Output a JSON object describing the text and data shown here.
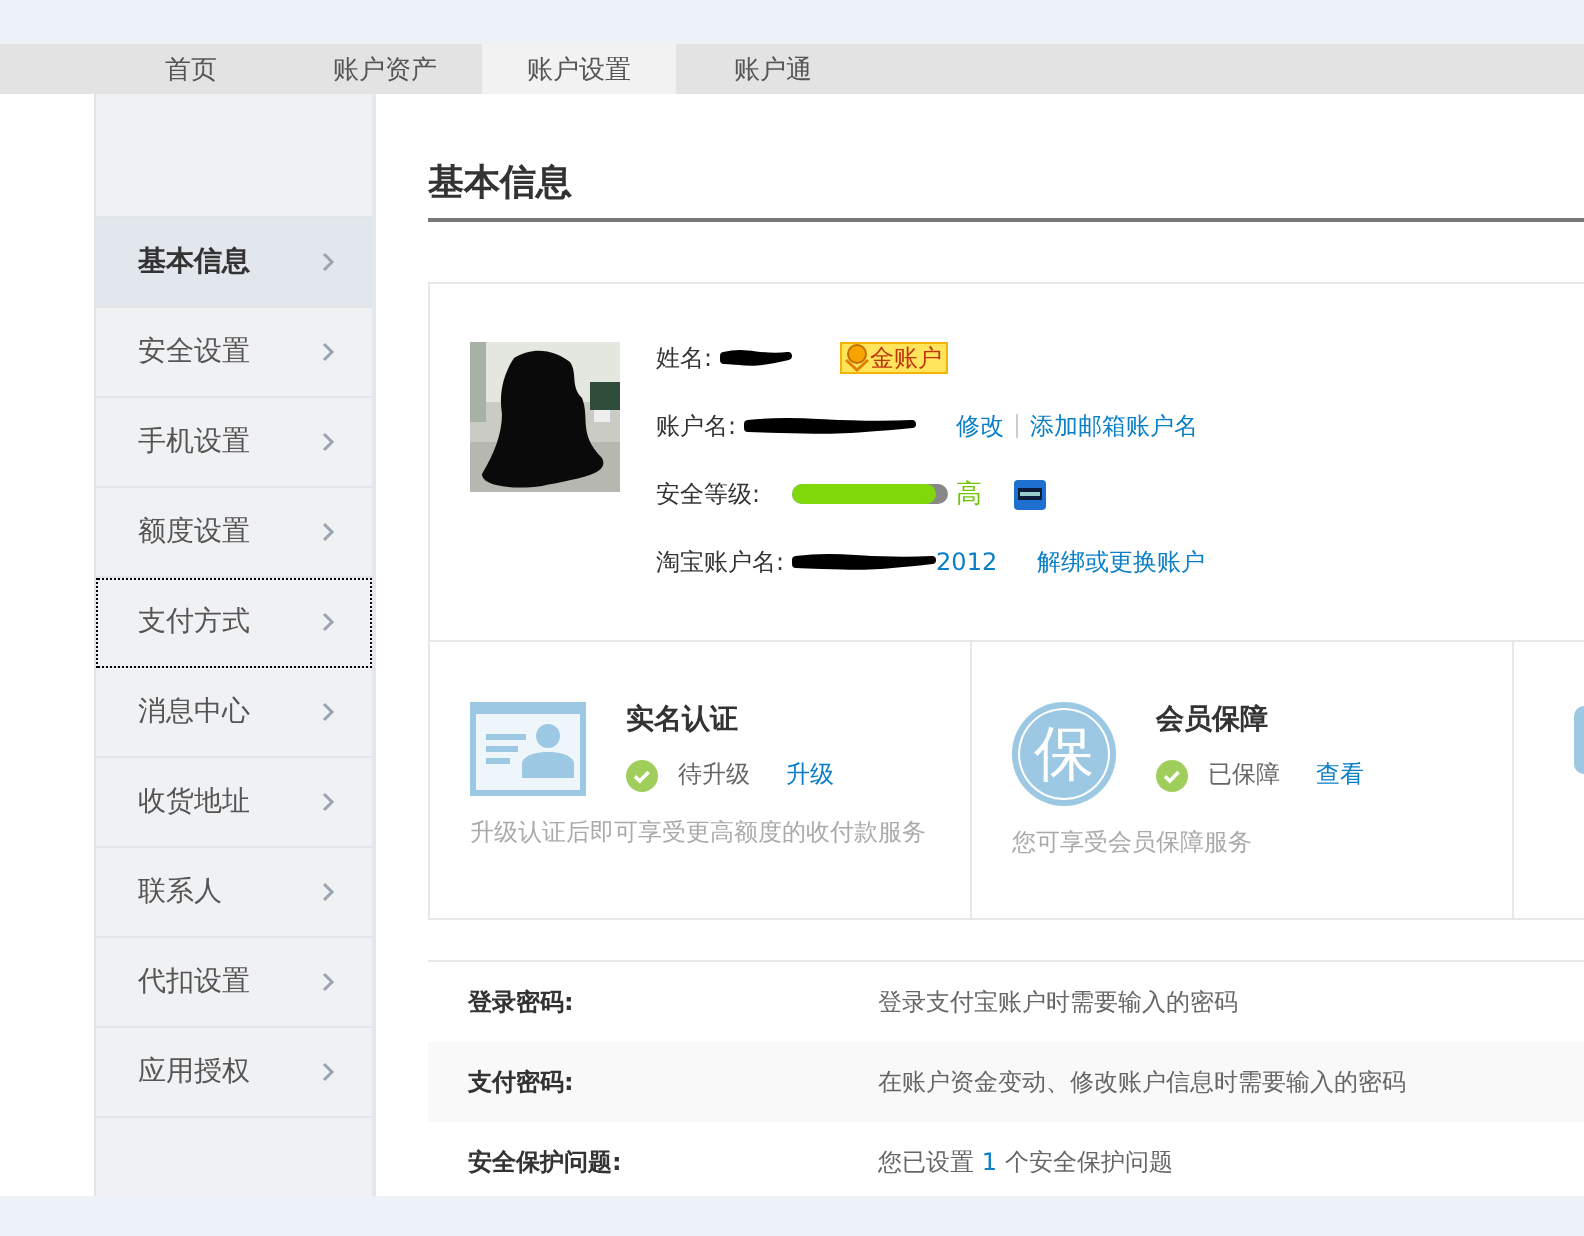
{
  "nav": {
    "tabs": [
      {
        "label": "首页",
        "selected": false
      },
      {
        "label": "账户资产",
        "selected": false
      },
      {
        "label": "账户设置",
        "selected": true
      },
      {
        "label": "账户通",
        "selected": false
      }
    ]
  },
  "sidebar": {
    "items": [
      {
        "label": "基本信息",
        "selected": true,
        "focused": false
      },
      {
        "label": "安全设置",
        "selected": false,
        "focused": false
      },
      {
        "label": "手机设置",
        "selected": false,
        "focused": false
      },
      {
        "label": "额度设置",
        "selected": false,
        "focused": false
      },
      {
        "label": "支付方式",
        "selected": false,
        "focused": true
      },
      {
        "label": "消息中心",
        "selected": false,
        "focused": false
      },
      {
        "label": "收货地址",
        "selected": false,
        "focused": false
      },
      {
        "label": "联系人",
        "selected": false,
        "focused": false
      },
      {
        "label": "代扣设置",
        "selected": false,
        "focused": false
      },
      {
        "label": "应用授权",
        "selected": false,
        "focused": false
      }
    ]
  },
  "page_title": "基本信息",
  "profile": {
    "fields": [
      {
        "kind": "name",
        "label": "姓名:",
        "badge": "金账户"
      },
      {
        "kind": "account",
        "label": "账户名:",
        "links": [
          "修改",
          "添加邮箱账户名"
        ]
      },
      {
        "kind": "level",
        "label": "安全等级:",
        "level": 0.92,
        "reading": "高"
      },
      {
        "kind": "taobao",
        "label": "淘宝账户名:",
        "value_tail": "2012",
        "links": [
          "解绑或更换账户"
        ]
      }
    ]
  },
  "cards": [
    {
      "kind": "id",
      "title": "实名认证",
      "status": "待升级",
      "link": "升级",
      "description": "升级认证后即可享受更高额度的收付款服务"
    },
    {
      "kind": "guarantee",
      "icon_text": "保",
      "title": "会员保障",
      "status": "已保障",
      "link": "查看",
      "description": "您可享受会员保障服务"
    },
    {
      "kind": "partial"
    }
  ],
  "security_rows": [
    {
      "label": "登录密码:",
      "description": [
        {
          "kind": "text",
          "text": "登录支付宝账户时需要输入的密码"
        }
      ]
    },
    {
      "label": "支付密码:",
      "description": [
        {
          "kind": "text",
          "text": "在账户资金变动、修改账户信息时需要输入的密码"
        }
      ]
    },
    {
      "label": "安全保护问题:",
      "description": [
        {
          "kind": "text",
          "text": "您已设置 "
        },
        {
          "kind": "count",
          "text": "1"
        },
        {
          "kind": "text",
          "text": " 个安全保护问题"
        }
      ]
    }
  ]
}
